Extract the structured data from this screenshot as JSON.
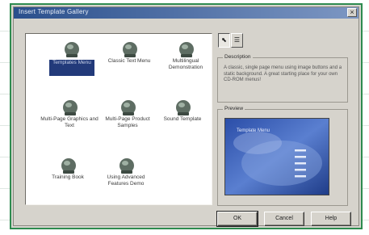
{
  "dialog": {
    "title": "Insert Template Gallery",
    "close_glyph": "×"
  },
  "templates": [
    {
      "label": "Templates Menu",
      "selected": true
    },
    {
      "label": "Classic Text Menu"
    },
    {
      "label": "Multilingual Demonstration"
    },
    {
      "label": "Multi-Page Graphics and Text"
    },
    {
      "label": "Multi-Page Product Samples"
    },
    {
      "label": "Sound Template"
    },
    {
      "label": "Training Book"
    },
    {
      "label": "Using Advanced Features Demo"
    }
  ],
  "view_buttons": {
    "large_icons": "⬉",
    "list": "☰"
  },
  "description": {
    "legend": "Description",
    "text": "A classic, single page menu using image buttons and a static background. A great starting place for your own CD-ROM menus!"
  },
  "preview": {
    "legend": "Preview",
    "screen_title": "Template Menu"
  },
  "buttons": {
    "ok": "OK",
    "cancel": "Cancel",
    "help": "Help"
  },
  "colors": {
    "frame": "#2e8b4f",
    "selection": "#223a7a",
    "title_gradient_start": "#2a4f8c"
  }
}
